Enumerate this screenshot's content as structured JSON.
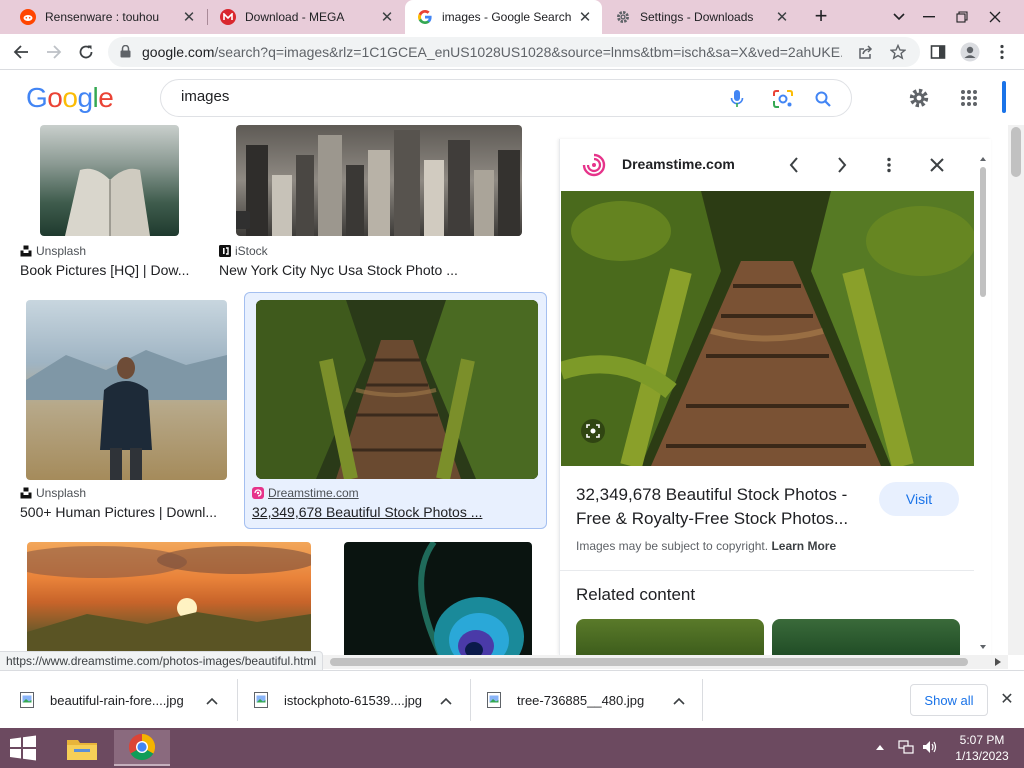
{
  "tabs": [
    {
      "title": "Rensenware : touhou",
      "favicon": "reddit-icon",
      "active": false
    },
    {
      "title": "Download - MEGA",
      "favicon": "mega-icon",
      "active": false
    },
    {
      "title": "images - Google Search",
      "favicon": "google-icon",
      "active": true
    },
    {
      "title": "Settings - Downloads",
      "favicon": "settings-icon",
      "active": false
    }
  ],
  "toolbar": {
    "url_host": "google.com",
    "url_rest": "/search?q=images&rlz=1C1GCEA_enUS1028US1028&source=lnms&tbm=isch&sa=X&ved=2ahUKE..."
  },
  "google": {
    "logo": "Google",
    "query": "images"
  },
  "results": [
    {
      "source": "Unsplash",
      "caption": "Book Pictures [HQ] | Dow..."
    },
    {
      "source": "iStock",
      "caption": "New York City Nyc Usa Stock Photo ..."
    },
    {
      "source": "Unsplash",
      "caption": "500+ Human Pictures | Downl..."
    },
    {
      "source": "Dreamstime.com",
      "caption": "32,349,678 Beautiful Stock Photos ..."
    }
  ],
  "preview": {
    "site": "Dreamstime.com",
    "title": "32,349,678 Beautiful Stock Photos - Free & Royalty-Free Stock Photos...",
    "visit_label": "Visit",
    "copyright_text": "Images may be subject to copyright.",
    "learn_more": "Learn More",
    "related_heading": "Related content"
  },
  "status_url": "https://www.dreamstime.com/photos-images/beautiful.html",
  "downloads": [
    {
      "name": "beautiful-rain-fore....jpg"
    },
    {
      "name": "istockphoto-61539....jpg"
    },
    {
      "name": "tree-736885__480.jpg"
    }
  ],
  "downloads_show_all": "Show all",
  "clock": {
    "time": "5:07 PM",
    "date": "1/13/2023"
  },
  "colors": {
    "accent": "#1a73e8",
    "tabstrip": "#e8ccd9",
    "taskbar": "#6c4a60"
  }
}
